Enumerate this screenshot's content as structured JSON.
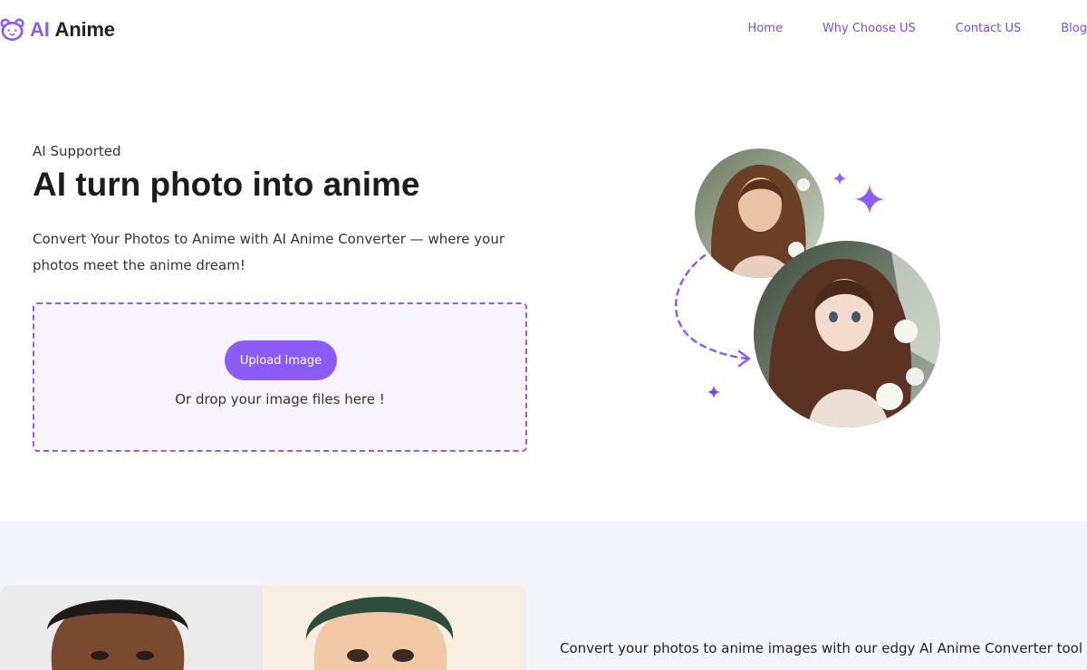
{
  "header": {
    "logo_ai": "AI",
    "logo_anime": "Anime",
    "nav": [
      {
        "label": "Home"
      },
      {
        "label": "Why Choose US"
      },
      {
        "label": "Contact US"
      },
      {
        "label": "Blog"
      }
    ]
  },
  "hero": {
    "eyebrow": "AI Supported",
    "title": "AI turn photo into anime",
    "description": "Convert Your Photos to Anime with AI Anime Converter — where your photos meet the anime dream!",
    "upload_label": "Upload image",
    "drop_hint": "Or drop your image files here !"
  },
  "lower": {
    "text": "Convert your photos to anime images with our edgy AI Anime Converter tool"
  },
  "colors": {
    "accent": "#8b5cf6",
    "nav": "#7c4ddb",
    "dropzone_bg": "#f7f4ff",
    "section_bg": "#f3f5fa"
  },
  "icons": [
    "bear-logo-icon",
    "sparkle-icon",
    "dashed-arrow-icon"
  ]
}
